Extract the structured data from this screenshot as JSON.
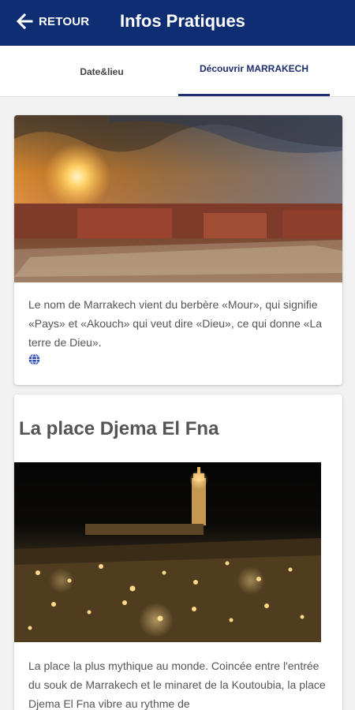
{
  "header": {
    "back_label": "RETOUR",
    "title": "Infos Pratiques"
  },
  "tabs": [
    {
      "label": "Date&lieu"
    },
    {
      "label": "Découvrir MARRAKECH"
    }
  ],
  "intro_card": {
    "text": "Le nom de Marrakech vient du berbère «Mour», qui signifie «Pays» et «Akouch» qui veut dire «Dieu», ce qui donne «La terre de Dieu»."
  },
  "place_card": {
    "title": "La place Djema El Fna",
    "text": "La place la plus mythique au monde. Coincée entre l'entrée du souk de Marrakech et le minaret de la Koutoubia, la place Djema El Fna vibre au rythme de"
  }
}
